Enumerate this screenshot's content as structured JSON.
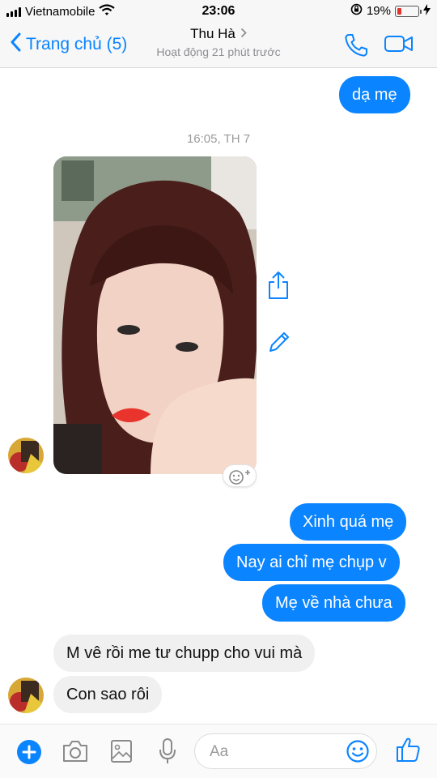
{
  "status_bar": {
    "carrier": "Vietnamobile",
    "time": "23:06",
    "battery_percent": "19%",
    "battery_level": 0.19,
    "icons": [
      "signal-icon",
      "wifi-icon",
      "rotation-lock-icon",
      "battery-icon",
      "charging-icon"
    ]
  },
  "header": {
    "back_label": "Trang chủ (5)",
    "contact_name": "Thu Hà",
    "active_status": "Hoạt động 21 phút trước",
    "icons": [
      "chevron-left-icon",
      "chevron-right-icon",
      "phone-icon",
      "video-camera-icon"
    ]
  },
  "messages": {
    "out_1": "dạ mẹ",
    "timestamp": "16:05, TH 7",
    "out_2": "Xinh quá mẹ",
    "out_3": "Nay ai chỉ mẹ chụp v",
    "out_4": "Mẹ về nhà chưa",
    "in_1": "M vê rồi me tư chupp cho vui mà",
    "in_2": "Con sao rôi"
  },
  "photo_actions": [
    "share-icon",
    "edit-pencil-icon",
    "add-reaction-icon"
  ],
  "composer": {
    "placeholder": "Aa",
    "icons": [
      "plus-icon",
      "camera-icon",
      "image-icon",
      "microphone-icon",
      "emoji-icon",
      "thumbs-up-icon"
    ]
  },
  "colors": {
    "accent": "#0a84ff",
    "outgoing_bubble": "#0a84ff",
    "incoming_bubble": "#f0f0f0",
    "battery_low": "#e0352b"
  }
}
